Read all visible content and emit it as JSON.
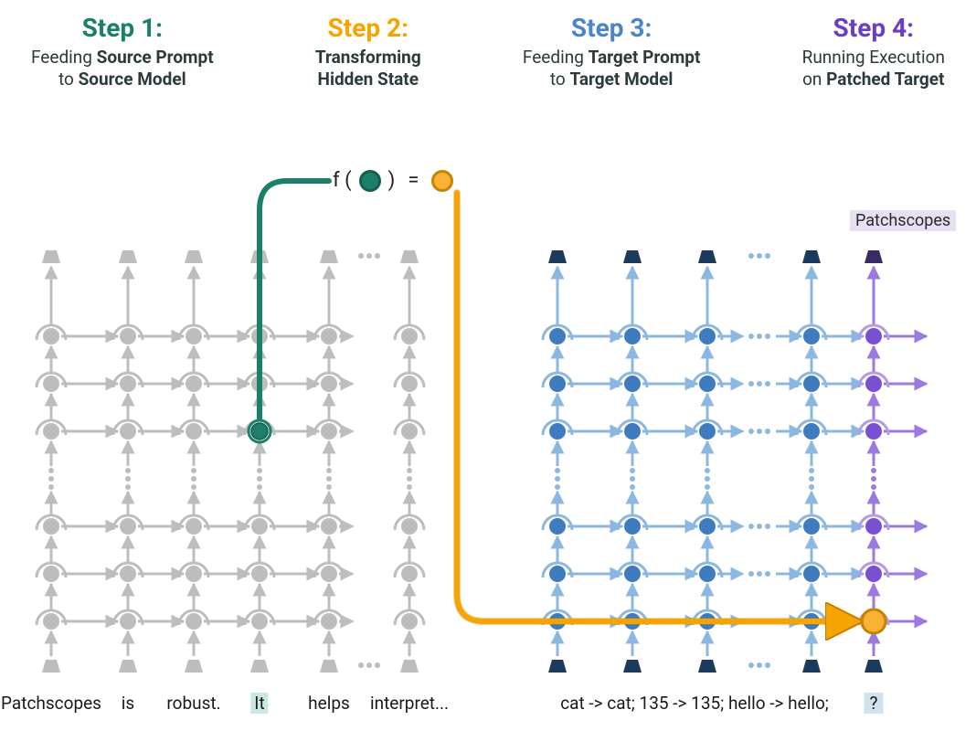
{
  "steps": {
    "s1": {
      "title": "Step 1:",
      "line1_a": "Feeding ",
      "line1_b": "Source Prompt",
      "line2_a": "to ",
      "line2_b": "Source Model"
    },
    "s2": {
      "title": "Step 2:",
      "line1_a": "Transforming",
      "line2_a": "Hidden State"
    },
    "s3": {
      "title": "Step 3:",
      "line1_a": "Feeding ",
      "line1_b": "Target Prompt",
      "line2_a": "to ",
      "line2_b": "Target Model"
    },
    "s4": {
      "title": "Step 4:",
      "line1_a": "Running Execution",
      "line2_a": "on ",
      "line2_b": "Patched Target"
    }
  },
  "eq": {
    "f": "f (",
    "close": ")",
    "eq": "="
  },
  "output_label": "Patchscopes",
  "tokens": {
    "left": [
      "Patchscopes",
      "is",
      "robust.",
      "It",
      "helps",
      "interpret..."
    ],
    "right_text": "cat -> cat; 135 -> 135; hello -> hello;",
    "right_q": "?"
  },
  "colors": {
    "teal": "#1b7f6b",
    "orange": "#f7a400",
    "blue_node": "#3f7bbf",
    "blue_light": "#8bb7e0",
    "dark_blue": "#1b3a5c",
    "purple": "#7b4fd1",
    "gray": "#bdbdbd"
  },
  "chart_data": {
    "type": "diagram",
    "source_model": {
      "columns": 6,
      "layers": 6,
      "tokens": [
        "Patchscopes",
        "is",
        "robust.",
        "It",
        "helps",
        "interpret..."
      ],
      "highlighted_token_index": 3,
      "extracted_hidden_state": {
        "column": 3,
        "layer": 3
      },
      "ellipsis_columns_between": [
        4,
        5
      ],
      "color": "gray"
    },
    "transformation": {
      "symbol": "f",
      "input_color": "teal",
      "output_color": "orange"
    },
    "target_model": {
      "columns": 5,
      "layers": 6,
      "tokens_prefix": "cat -> cat; 135 -> 135; hello -> hello;",
      "patched_token": "?",
      "patched_position": {
        "column": 4,
        "layer": 0
      },
      "ellipsis_columns_between": [
        2,
        3
      ],
      "column_colors": [
        "blue",
        "blue",
        "blue",
        "blue",
        "purple"
      ],
      "output_top": "Patchscopes"
    }
  }
}
